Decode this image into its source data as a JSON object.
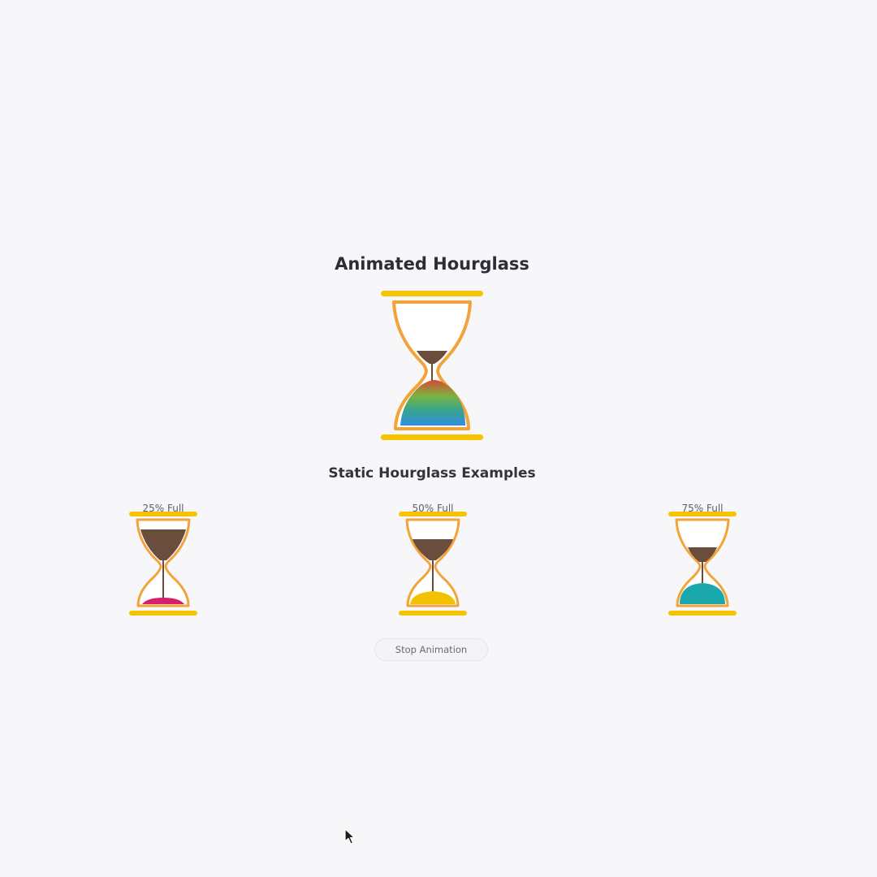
{
  "main": {
    "title": "Animated Hourglass",
    "hourglass": {
      "colors": {
        "frame": "#f2a33a",
        "bar": "#f7c300",
        "sand_top": "#6b4d3d",
        "sand_gradient": [
          "#d84a32",
          "#7ab342",
          "#3aa58a",
          "#2f8fe0"
        ]
      }
    }
  },
  "examples": {
    "title": "Static Hourglass Examples",
    "items": [
      {
        "label": "25% Full",
        "fill": 0.25,
        "sand_color": "#d6206d"
      },
      {
        "label": "50% Full",
        "fill": 0.5,
        "sand_color": "#f2c200"
      },
      {
        "label": "75% Full",
        "fill": 0.75,
        "sand_color": "#1aa8ad"
      }
    ]
  },
  "controls": {
    "stop_label": "Stop Animation"
  }
}
